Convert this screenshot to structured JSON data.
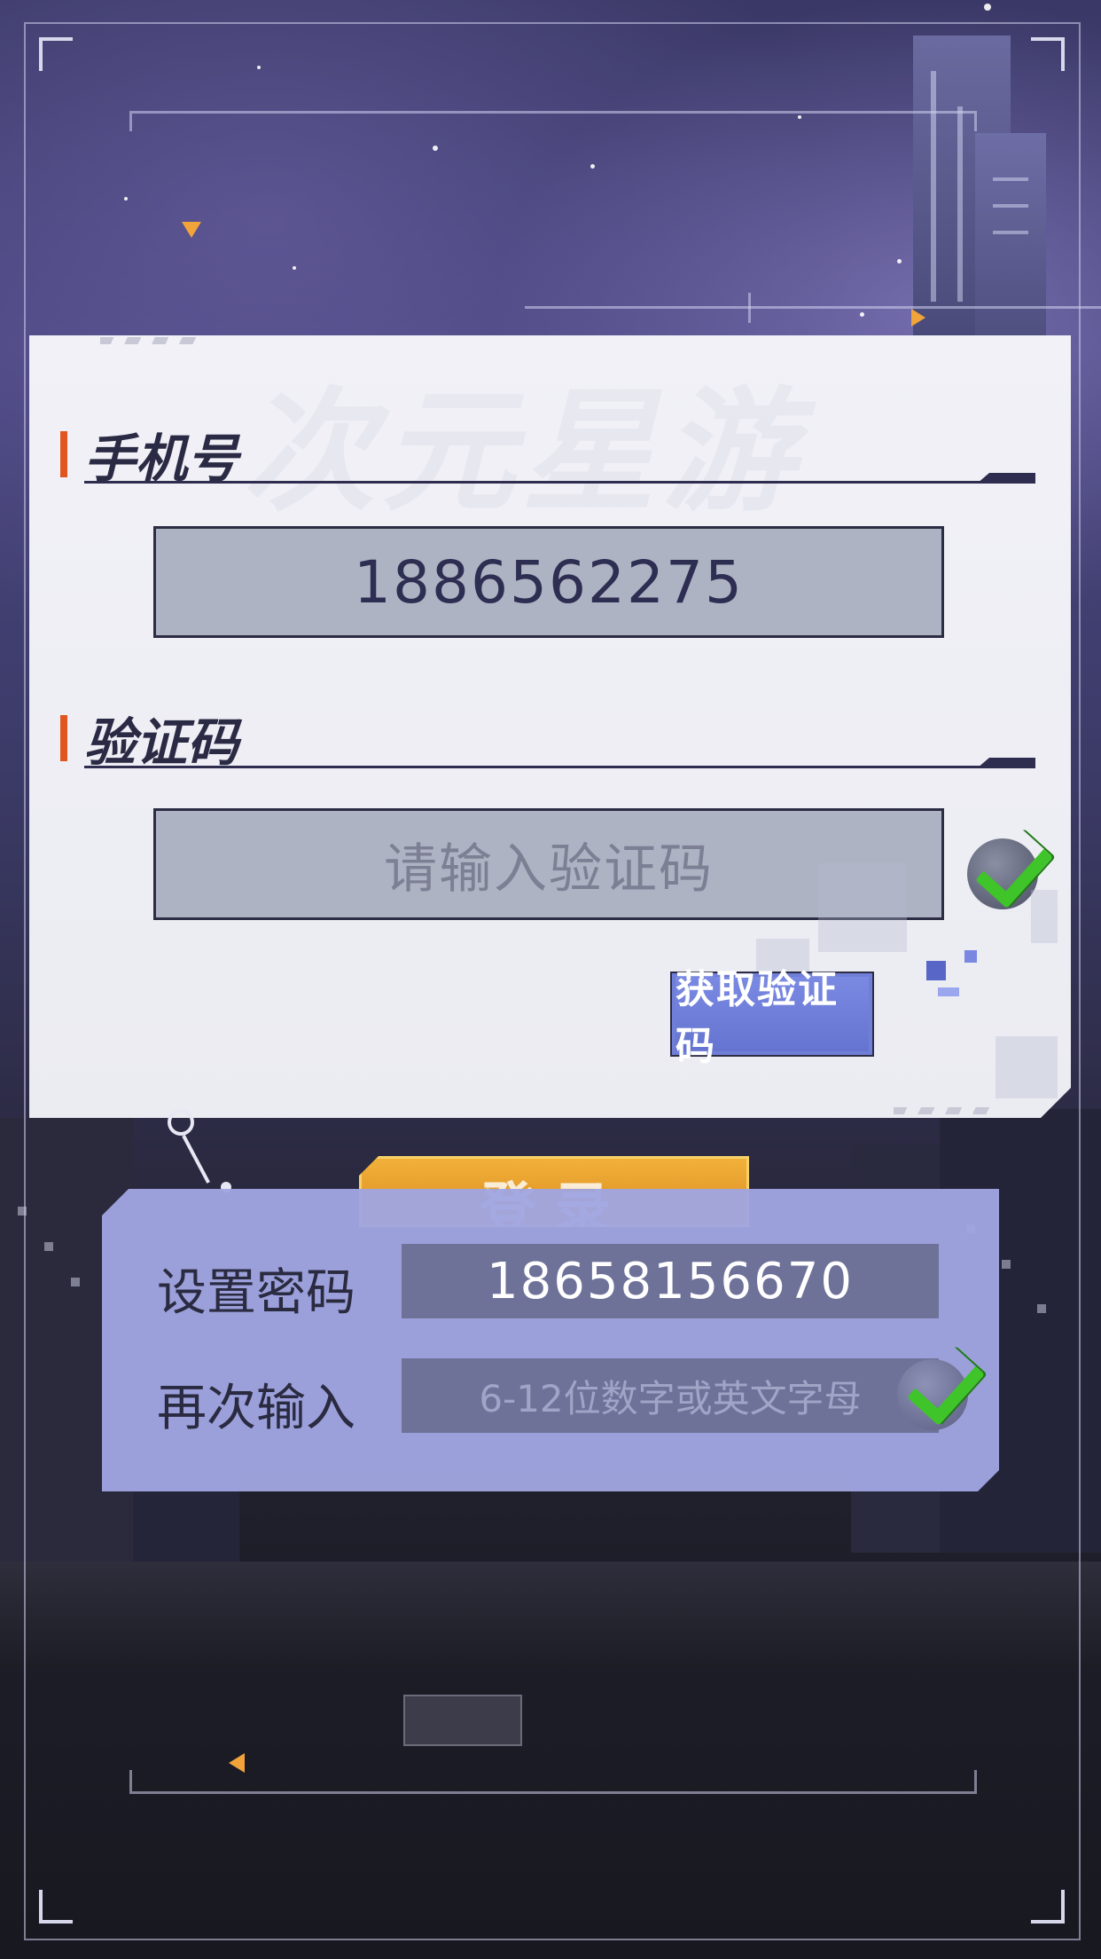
{
  "watermark": {
    "text": "次元星游"
  },
  "phone": {
    "label": "手机号",
    "value": "1886562275"
  },
  "code": {
    "label": "验证码",
    "placeholder": "请输入验证码",
    "get_code_label": "获取验证码"
  },
  "login": {
    "label": "登录"
  },
  "password": {
    "set_label": "设置密码",
    "set_value": "18658156670",
    "confirm_label": "再次输入",
    "confirm_placeholder": "6-12位数字或英文字母"
  },
  "colors": {
    "accent_orange": "#e0561e",
    "button_blue": "#6f7ed6",
    "check_green": "#3fc42a",
    "login_gold": "#e39e2a"
  }
}
